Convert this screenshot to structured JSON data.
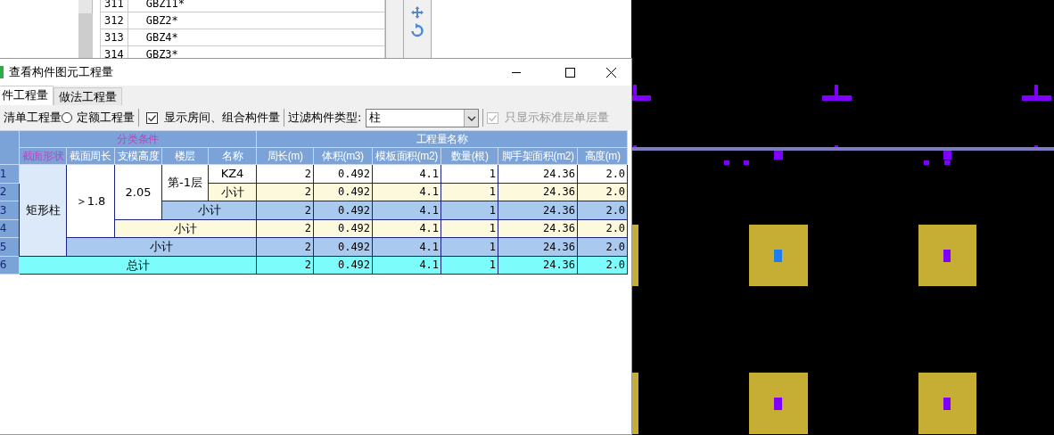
{
  "background_list": {
    "rows": [
      {
        "number": "311",
        "name": "GBZ11*"
      },
      {
        "number": "312",
        "name": "GBZ2*"
      },
      {
        "number": "313",
        "name": "GBZ4*"
      },
      {
        "number": "314",
        "name": "GBZ3*"
      }
    ]
  },
  "dialog": {
    "title": "查看构件图元工程量",
    "tabs": [
      {
        "label": "件工程量",
        "selected": true
      },
      {
        "label": "做法工程量",
        "selected": false
      }
    ],
    "toolbar": {
      "modes": [
        {
          "label": "清单工程量"
        },
        {
          "label": "定额工程量",
          "selected": false
        }
      ],
      "show_rooms": {
        "label": "显示房间、组合构件量",
        "checked": true
      },
      "filter_label": "过滤构件类型:",
      "filter_value": "柱",
      "standard_floor": {
        "label": "只显示标准层单层量",
        "checked": true,
        "disabled": true
      }
    },
    "table": {
      "group_headers": [
        {
          "text": "分类条件",
          "highlighted": true
        },
        {
          "text": "工程量名称",
          "highlighted": false
        }
      ],
      "columns": [
        {
          "text": "截面形状",
          "highlighted": true
        },
        {
          "text": "截面周长",
          "highlighted": false
        },
        {
          "text": "支模高度",
          "highlighted": false
        },
        {
          "text": "楼层",
          "highlighted": false
        },
        {
          "text": "名称",
          "highlighted": false
        },
        {
          "text": "周长(m)",
          "highlighted": false
        },
        {
          "text": "体积(m3)",
          "highlighted": false
        },
        {
          "text": "模板面积(m2)",
          "highlighted": false
        },
        {
          "text": "数量(根)",
          "highlighted": false
        },
        {
          "text": "脚手架面积(m2)",
          "highlighted": false
        },
        {
          "text": "高度(m)",
          "highlighted": false
        }
      ],
      "rows": [
        {
          "number": "1",
          "kind": "item",
          "labels": [
            {
              "text": "矩形柱",
              "shaded": true
            },
            {
              "text": "＞1.8",
              "shaded": false
            },
            {
              "text": "2.05",
              "shaded": false
            },
            {
              "text": "第-1层",
              "shaded": false
            },
            {
              "text": "KZ4",
              "shaded": false
            }
          ],
          "values": [
            "2",
            "0.492",
            "4.1",
            "1",
            "24.36",
            "2.0"
          ]
        },
        {
          "number": "2",
          "kind": "subtotal",
          "labels": [
            {
              "text": "小计"
            }
          ],
          "values": [
            "2",
            "0.492",
            "4.1",
            "1",
            "24.36",
            "2.0"
          ]
        },
        {
          "number": "3",
          "kind": "group_subtotal",
          "labels": [
            {
              "text": "小计"
            }
          ],
          "values": [
            "2",
            "0.492",
            "4.1",
            "1",
            "24.36",
            "2.0"
          ]
        },
        {
          "number": "4",
          "kind": "subtotal",
          "labels": [
            {
              "text": "小计"
            }
          ],
          "values": [
            "2",
            "0.492",
            "4.1",
            "1",
            "24.36",
            "2.0"
          ]
        },
        {
          "number": "5",
          "kind": "group_subtotal",
          "labels": [
            {
              "text": "小计"
            }
          ],
          "values": [
            "2",
            "0.492",
            "4.1",
            "1",
            "24.36",
            "2.0"
          ]
        },
        {
          "number": "6",
          "kind": "total",
          "labels": [
            {
              "text": "总计"
            }
          ],
          "values": [
            "2",
            "0.492",
            "4.1",
            "1",
            "24.36",
            "2.0"
          ]
        }
      ]
    }
  }
}
